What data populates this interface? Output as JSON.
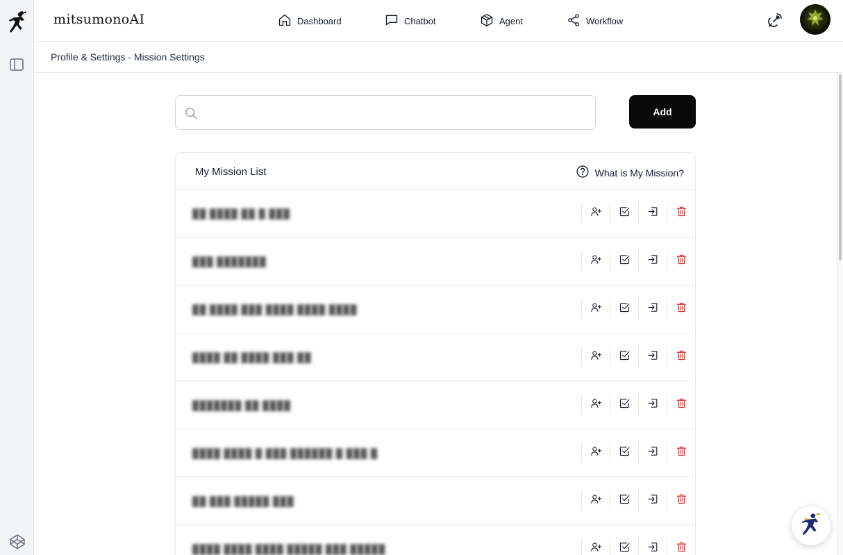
{
  "app": {
    "brand": "mitsumonoAI"
  },
  "nav": [
    {
      "label": "Dashboard",
      "icon": "home-icon"
    },
    {
      "label": "Chatbot",
      "icon": "chat-icon"
    },
    {
      "label": "Agent",
      "icon": "cube-icon"
    },
    {
      "label": "Workflow",
      "icon": "share-icon"
    }
  ],
  "breadcrumb": "Profile & Settings - Mission Settings",
  "search": {
    "value": "",
    "placeholder": ""
  },
  "add_label": "Add",
  "list": {
    "title": "My Mission List",
    "help_label": "What is My Mission?",
    "rows": [
      {
        "name": "██ ████ ██ █ ███"
      },
      {
        "name": "███ ███████"
      },
      {
        "name": "██ ████ ███ ████ ████ ████"
      },
      {
        "name": "████ ██ ████ ███ ██"
      },
      {
        "name": "███████ ██ ████"
      },
      {
        "name": "████ ████ █ ███ ██████ █ ███ █"
      },
      {
        "name": "██ ███ █████ ███"
      },
      {
        "name": "████ ████ ████ █████ ███ █████"
      }
    ]
  },
  "row_actions": [
    "user-plus-icon",
    "check-square-icon",
    "sign-in-icon",
    "trash-icon"
  ],
  "colors": {
    "accent": "#0a0a0a",
    "danger": "#dc2626",
    "rail_bg": "#f3f4f6",
    "border": "#e5e7eb"
  }
}
